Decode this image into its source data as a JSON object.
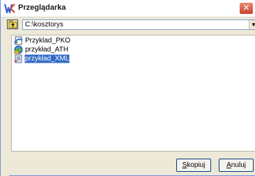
{
  "window": {
    "title": "Przeglądarka",
    "close_glyph": "✕",
    "app_icon": "app-logo-icon"
  },
  "toolbar": {
    "up_folder_icon": "folder-up-icon",
    "path": "C:\\kosztorys",
    "dropdown_arrow": "▼"
  },
  "files": [
    {
      "name": "Przyklad_PKO",
      "icon": "web-document-icon",
      "selected": false
    },
    {
      "name": "przykład_ATH",
      "icon": "web-globe-icon",
      "selected": false
    },
    {
      "name": "przykład_XML",
      "icon": "xml-document-icon",
      "selected": true
    }
  ],
  "buttons": {
    "copy": {
      "accel": "S",
      "rest": "kopiuj"
    },
    "cancel": {
      "accel": "A",
      "rest": "nuluj"
    }
  },
  "colors": {
    "selection": "#316ac5",
    "close_button": "#c6452d",
    "window_background": "#ece9d8"
  }
}
